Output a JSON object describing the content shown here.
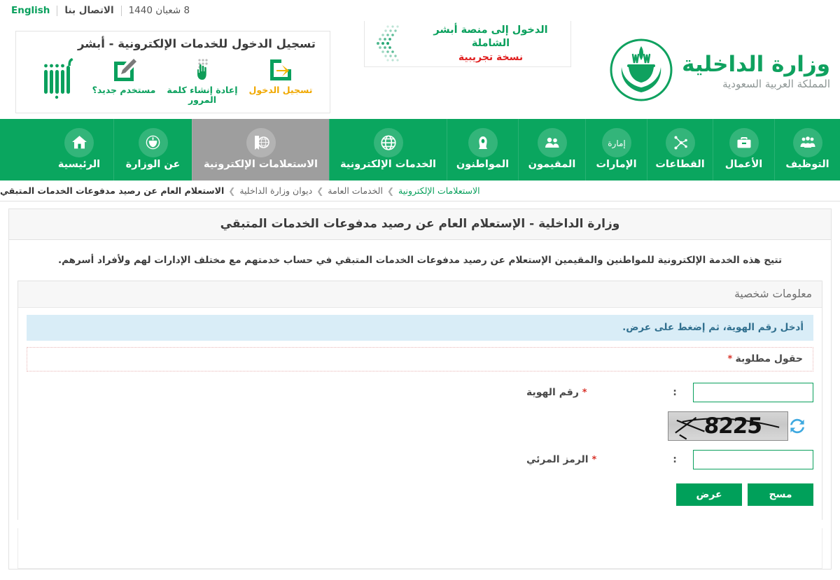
{
  "topbar": {
    "date": "8 شعبان 1440",
    "contact_label": "الاتصال بنا",
    "english_label": "English"
  },
  "absher": {
    "title": "تسجيل الدخول للخدمات الإلكترونية - أبشر",
    "logo_name": "absher-logo",
    "items": [
      {
        "label": "مستخدم جديد؟",
        "icon": "edit-square-icon",
        "color": "#0aa05d"
      },
      {
        "label": "إعادة إنشاء كلمة المرور",
        "icon": "keypad-hand-icon",
        "color": "#0aa05d"
      },
      {
        "label": "تسجيل الدخول",
        "icon": "login-arrow-icon",
        "color": "#f0a800"
      }
    ]
  },
  "promo": {
    "line1": "الدخول إلى منصة أبشر الشاملة",
    "line2": "نسخة تجريبية",
    "icon": "chevron-dots-icon"
  },
  "ministry": {
    "name": "وزارة الداخلية",
    "subtitle": "المملكة العربية السعودية",
    "emblem": "saudi-emblem-icon"
  },
  "nav": {
    "items": [
      {
        "label": "الرئيسية",
        "icon": "home-icon",
        "active": false
      },
      {
        "label": "عن الوزارة",
        "icon": "ministry-emblem-icon",
        "active": false
      },
      {
        "label": "الاستعلامات الإلكترونية",
        "icon": "search-globe-icon",
        "active": true
      },
      {
        "label": "الخدمات الإلكترونية",
        "icon": "globe-icon",
        "active": false
      },
      {
        "label": "المواطنون",
        "icon": "citizen-icon",
        "active": false
      },
      {
        "label": "المقيمون",
        "icon": "residents-icon",
        "active": false
      },
      {
        "label": "الإمارات",
        "icon": "calligraphy-icon",
        "active": false
      },
      {
        "label": "القطاعات",
        "icon": "network-icon",
        "active": false
      },
      {
        "label": "الأعمال",
        "icon": "briefcase-icon",
        "active": false
      },
      {
        "label": "التوظيف",
        "icon": "people-group-icon",
        "active": false
      }
    ]
  },
  "breadcrumb": {
    "separator": "❯",
    "items": [
      "الاستعلامات الإلكترونية",
      "الخدمات العامة",
      "ديوان وزارة الداخلية",
      "الاستعلام العام عن رصيد مدفوعات الخدمات المتبقي"
    ]
  },
  "page": {
    "title": "وزارة الداخلية - الإستعلام العام عن رصيد مدفوعات الخدمات المتبقي",
    "description": "تتيح هذه الخدمة الإلكترونية للمواطنين والمقيمين الإستعلام عن رصيد مدفوعات الخدمات المتبقي في حساب خدمتهم مع مختلف الإدارات لهم ولأفراد أسرهم."
  },
  "form": {
    "section_title": "معلومات شخصية",
    "info_text": "أدخل رقم الهوية، ثم إضغط على عرض.",
    "required_label": "حقول مطلوبة",
    "required_asterisk": "*",
    "colon": ":",
    "fields": [
      {
        "label": "رقم الهوية",
        "required": true,
        "value": "",
        "placeholder": "",
        "name": "id-number-input"
      },
      {
        "label": "الرمز المرئي",
        "required": true,
        "value": "",
        "placeholder": "",
        "name": "captcha-input"
      }
    ],
    "captcha": {
      "value": "8225",
      "refresh_icon": "refresh-icon",
      "refresh_color": "#3fa9e0"
    },
    "buttons": [
      {
        "label": "عرض",
        "name": "view-button",
        "color": "#00a05a"
      },
      {
        "label": "مسح",
        "name": "clear-button",
        "color": "#00a05a"
      }
    ]
  },
  "colors": {
    "brand_green": "#0aa65f",
    "button_green": "#00a05a",
    "active_tab_gray": "#9e9e9e",
    "info_bg": "#d9edf7",
    "info_text": "#31708f",
    "required_red": "#d9342b",
    "promo_red": "#e02020",
    "absher_orange": "#f0a800"
  }
}
